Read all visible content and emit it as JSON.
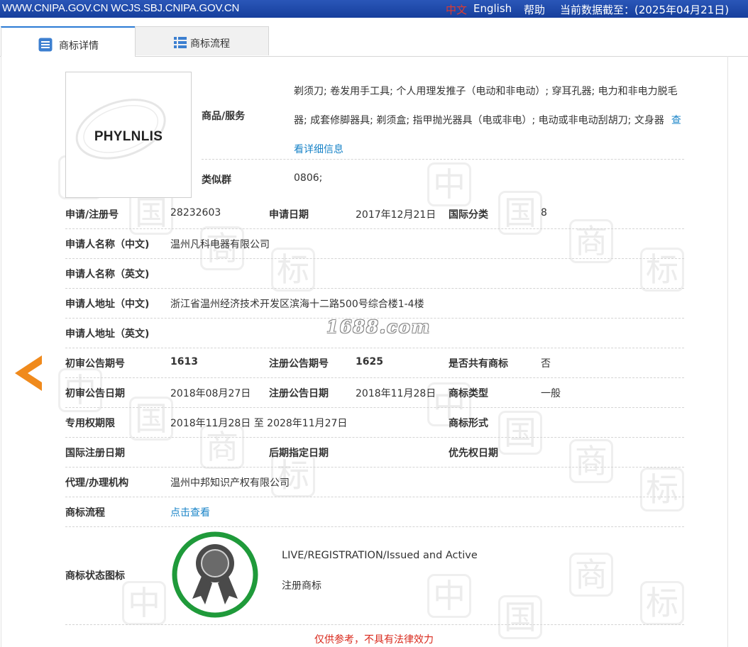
{
  "topbar": {
    "site": "WWW.CNIPA.GOV.CN WCJS.SBJ.CNIPA.GOV.CN",
    "lang_cn": "中文",
    "lang_en": "English",
    "help": "帮助",
    "data_as_of": "当前数据截至：(2025年04月21日)"
  },
  "tabs": [
    {
      "label": "商标详情",
      "active": true,
      "icon": "document-list-icon"
    },
    {
      "label": "商标流程",
      "active": false,
      "icon": "list-grid-icon"
    }
  ],
  "logo": {
    "mark_text": "PHYLNLIS"
  },
  "goods_services": {
    "label": "商品/服务",
    "text": "剃须刀; 卷发用手工具; 个人用理发推子（电动和非电动）; 穿耳孔器; 电力和非电力脱毛器; 成套修脚器具; 剃须盒; 指甲抛光器具（电或非电）; 电动或非电动刮胡刀; 文身器",
    "detail_link": "查看详细信息"
  },
  "similar_group": {
    "label": "类似群",
    "value": "0806;"
  },
  "fields": {
    "app_no_label": "申请/注册号",
    "app_no": "28232603",
    "app_date_label": "申请日期",
    "app_date": "2017年12月21日",
    "intl_class_label": "国际分类",
    "intl_class": "8",
    "applicant_cn_label": "申请人名称（中文)",
    "applicant_cn": "温州凡科电器有限公司",
    "applicant_en_label": "申请人名称（英文)",
    "applicant_en": "",
    "address_cn_label": "申请人地址（中文)",
    "address_cn": "浙江省温州经济技术开发区滨海十二路500号综合楼1-4楼",
    "address_en_label": "申请人地址（英文)",
    "address_en": "",
    "prelim_pub_no_label": "初审公告期号",
    "prelim_pub_no": "1613",
    "reg_pub_no_label": "注册公告期号",
    "reg_pub_no": "1625",
    "shared_label": "是否共有商标",
    "shared": "否",
    "prelim_pub_date_label": "初审公告日期",
    "prelim_pub_date": "2018年08月27日",
    "reg_pub_date_label": "注册公告日期",
    "reg_pub_date": "2018年11月28日",
    "mark_type_label": "商标类型",
    "mark_type": "一般",
    "exclusive_period_label": "专用权期限",
    "exclusive_period": "2018年11月28日 至 2028年11月27日",
    "mark_form_label": "商标形式",
    "mark_form": "",
    "intl_reg_date_label": "国际注册日期",
    "intl_reg_date": "",
    "later_designation_label": "后期指定日期",
    "later_designation": "",
    "priority_date_label": "优先权日期",
    "priority_date": "",
    "agent_label": "代理/办理机构",
    "agent": "温州中邦知识产权有限公司",
    "process_label": "商标流程",
    "process_link": "点击查看",
    "status_label": "商标状态图标"
  },
  "status": {
    "en": "LIVE/REGISTRATION/Issued and Active",
    "cn": "注册商标",
    "icon": "registered-award-icon",
    "ring_color": "#1f9a3a"
  },
  "watermark_site": "1688.com",
  "disclaimer": "仅供参考，不具有法律效力",
  "colors": {
    "topbar": "#1f4aa8",
    "link": "#1a84c8",
    "disclaimer": "#d9291c",
    "nav_arrow": "#f08a1c"
  }
}
